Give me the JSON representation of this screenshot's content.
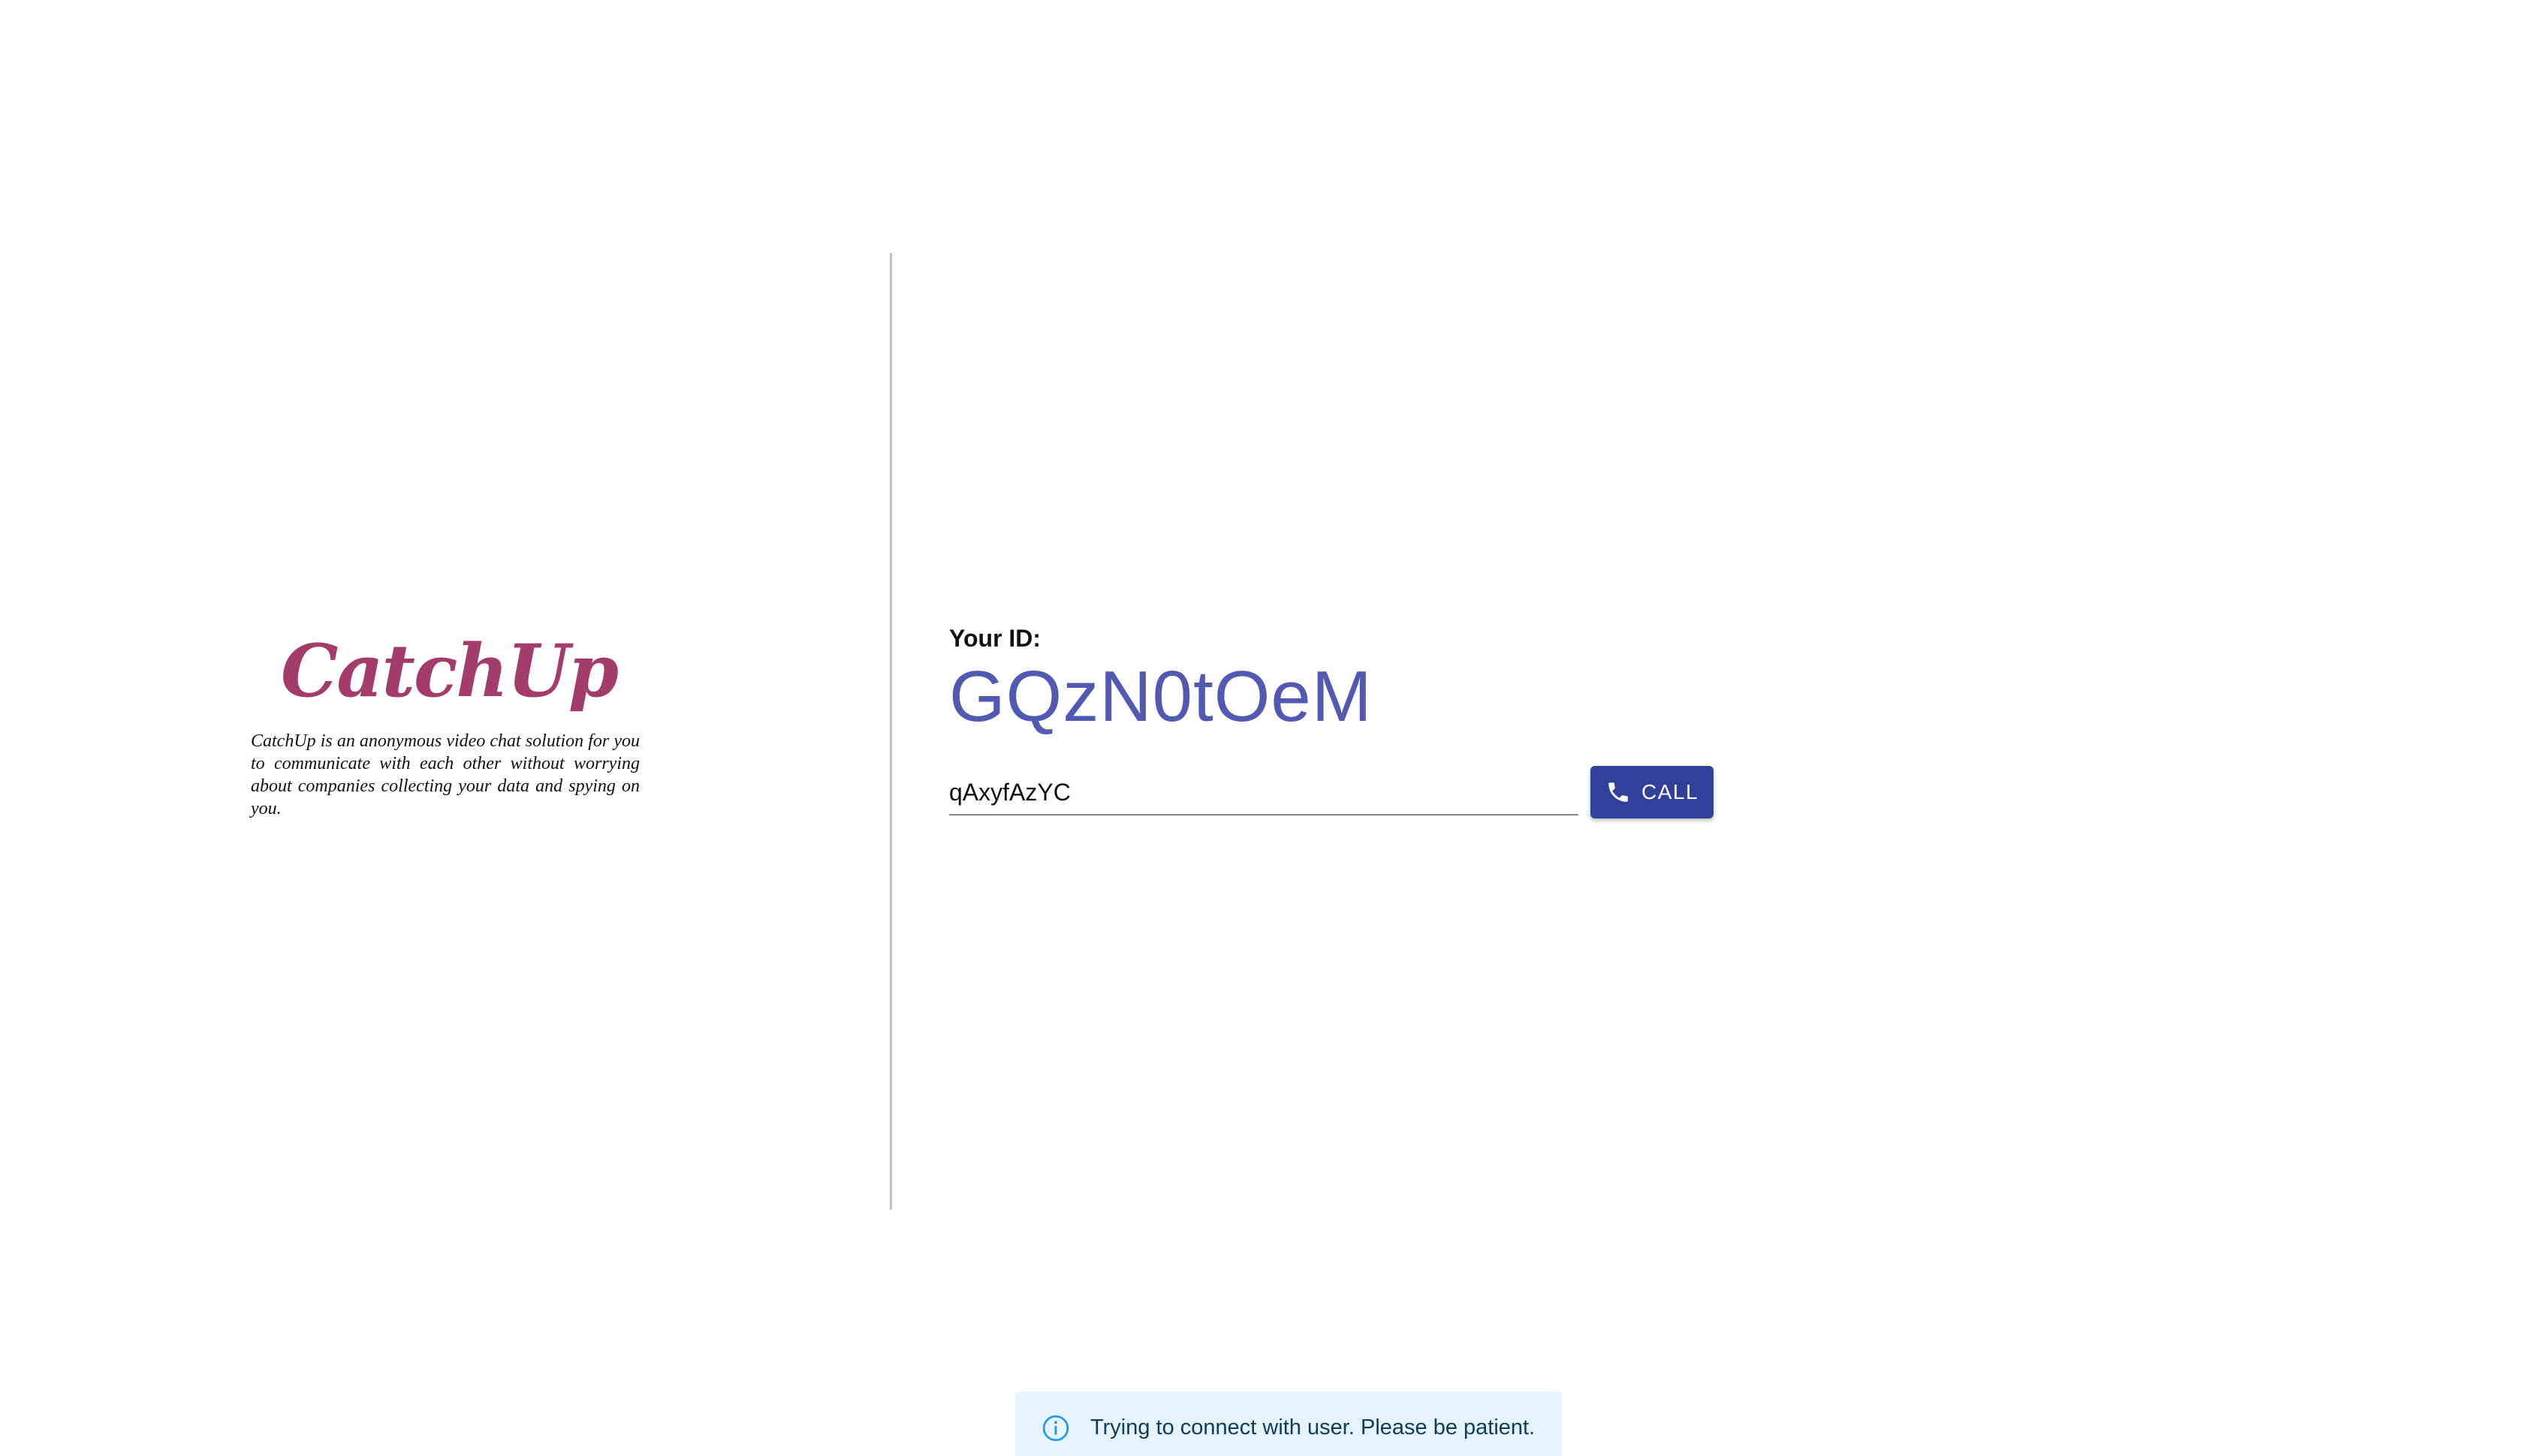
{
  "brand": {
    "logo_text": "CatchUp",
    "description": "CatchUp is an anonymous video chat solution for you to communicate with each other without worrying about companies collecting your data and spying on you.",
    "logo_color": "#a33b6b"
  },
  "connect": {
    "id_label": "Your ID:",
    "id_value": "GQzN0tOeM",
    "id_color": "#5159b2",
    "peer_input_value": "qAxyfAzYC",
    "call_button": {
      "label": "CALL",
      "icon": "phone-icon",
      "color": "#31409b"
    }
  },
  "toast": {
    "icon": "info-icon",
    "message": "Trying to connect with user. Please be patient.",
    "severity": "info",
    "background": "#e8f4fd"
  }
}
